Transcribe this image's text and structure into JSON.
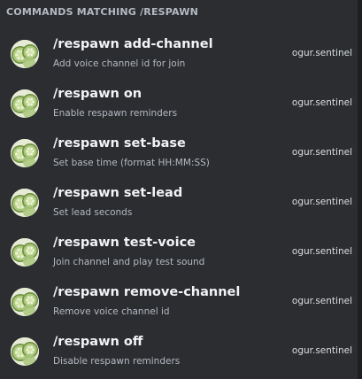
{
  "header": {
    "title": "COMMANDS MATCHING /RESPAWN"
  },
  "commands": [
    {
      "name": "/respawn add-channel",
      "description": "Add voice channel id for join",
      "app": "ogur.sentinel"
    },
    {
      "name": "/respawn on",
      "description": "Enable respawn reminders",
      "app": "ogur.sentinel"
    },
    {
      "name": "/respawn set-base",
      "description": "Set base time (format HH:MM:SS)",
      "app": "ogur.sentinel"
    },
    {
      "name": "/respawn set-lead",
      "description": "Set lead seconds",
      "app": "ogur.sentinel"
    },
    {
      "name": "/respawn test-voice",
      "description": "Join channel and play test sound",
      "app": "ogur.sentinel"
    },
    {
      "name": "/respawn remove-channel",
      "description": "Remove voice channel id",
      "app": "ogur.sentinel"
    },
    {
      "name": "/respawn off",
      "description": "Disable respawn reminders",
      "app": "ogur.sentinel"
    }
  ],
  "colors": {
    "background": "#2b2d31",
    "title_text": "#f2f3f5",
    "secondary_text": "#b5bac1",
    "avatar_bg": "#e6ebd6",
    "cucumber_green": "#a9c77c"
  },
  "icons": {
    "avatar": "cucumber-slices-avatar-icon"
  }
}
